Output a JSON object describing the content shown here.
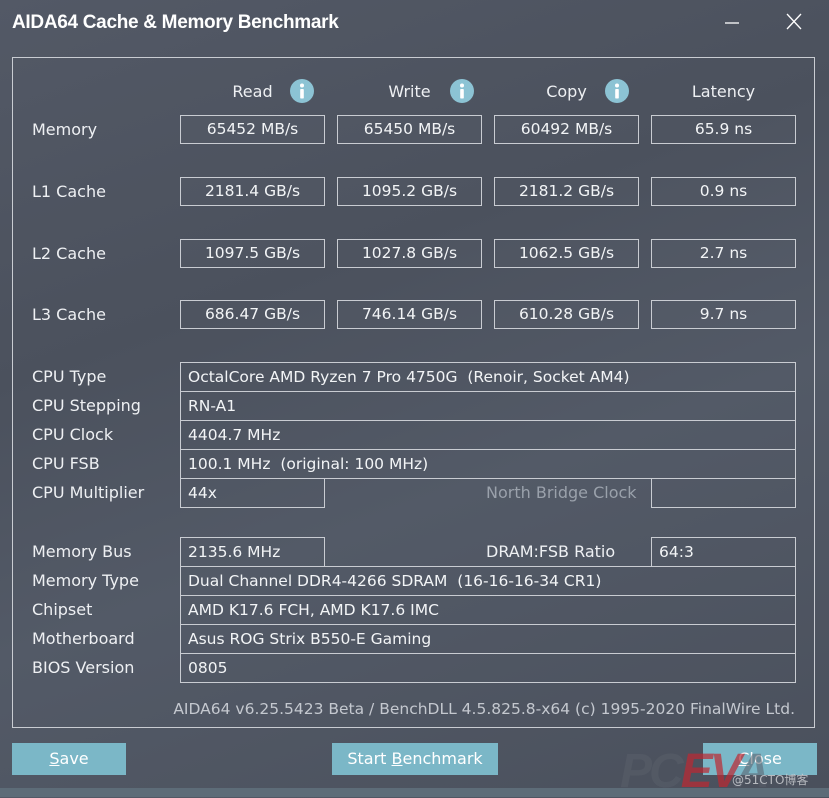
{
  "window": {
    "title": "AIDA64 Cache & Memory Benchmark",
    "minimize_icon": "minimize-icon",
    "close_icon": "close-icon"
  },
  "benchmark": {
    "columns": [
      {
        "label": "Read",
        "has_info": true
      },
      {
        "label": "Write",
        "has_info": true
      },
      {
        "label": "Copy",
        "has_info": true
      },
      {
        "label": "Latency",
        "has_info": false
      }
    ],
    "rows": [
      {
        "label": "Memory",
        "values": [
          "65452 MB/s",
          "65450 MB/s",
          "60492 MB/s",
          "65.9 ns"
        ]
      },
      {
        "label": "L1 Cache",
        "values": [
          "2181.4 GB/s",
          "1095.2 GB/s",
          "2181.2 GB/s",
          "0.9 ns"
        ]
      },
      {
        "label": "L2 Cache",
        "values": [
          "1097.5 GB/s",
          "1027.8 GB/s",
          "1062.5 GB/s",
          "2.7 ns"
        ]
      },
      {
        "label": "L3 Cache",
        "values": [
          "686.47 GB/s",
          "746.14 GB/s",
          "610.28 GB/s",
          "9.7 ns"
        ]
      }
    ]
  },
  "cpu_info": {
    "cpu_type": {
      "label": "CPU Type",
      "value": "OctalCore AMD Ryzen 7 Pro 4750G  (Renoir, Socket AM4)"
    },
    "cpu_stepping": {
      "label": "CPU Stepping",
      "value": "RN-A1"
    },
    "cpu_clock": {
      "label": "CPU Clock",
      "value": "4404.7 MHz"
    },
    "cpu_fsb": {
      "label": "CPU FSB",
      "value": "100.1 MHz  (original: 100 MHz)"
    },
    "cpu_multiplier": {
      "label": "CPU Multiplier",
      "value": "44x"
    },
    "north_bridge_clock": {
      "label": "North Bridge Clock",
      "value": ""
    }
  },
  "memory_info": {
    "memory_bus": {
      "label": "Memory Bus",
      "value": "2135.6 MHz"
    },
    "dram_fsb_ratio": {
      "label": "DRAM:FSB Ratio",
      "value": "64:3"
    },
    "memory_type": {
      "label": "Memory Type",
      "value": "Dual Channel DDR4-4266 SDRAM  (16-16-16-34 CR1)"
    },
    "chipset": {
      "label": "Chipset",
      "value": "AMD K17.6 FCH, AMD K17.6 IMC"
    },
    "motherboard": {
      "label": "Motherboard",
      "value": "Asus ROG Strix B550-E Gaming"
    },
    "bios_version": {
      "label": "BIOS Version",
      "value": "0805"
    }
  },
  "footer": {
    "version_text": "AIDA64 v6.25.5423 Beta / BenchDLL 4.5.825.8-x64  (c) 1995-2020 FinalWire Ltd."
  },
  "buttons": {
    "save": {
      "mnemonic": "S",
      "rest": "ave"
    },
    "start_benchmark": {
      "before": "Start ",
      "mnemonic": "B",
      "rest": "enchmark"
    },
    "close": {
      "mnemonic": "C",
      "rest": "lose"
    }
  },
  "watermark": {
    "brand_a": "PC",
    "brand_b": "EV",
    "brand_c": "A",
    "source": "@51CTO博客"
  },
  "colors": {
    "background": "#4d535f",
    "border": "#c9ccd2",
    "accent_button": "#7bb7c7",
    "info_icon": "#8cc3d4",
    "dimmed_label": "#9aa1ab"
  }
}
